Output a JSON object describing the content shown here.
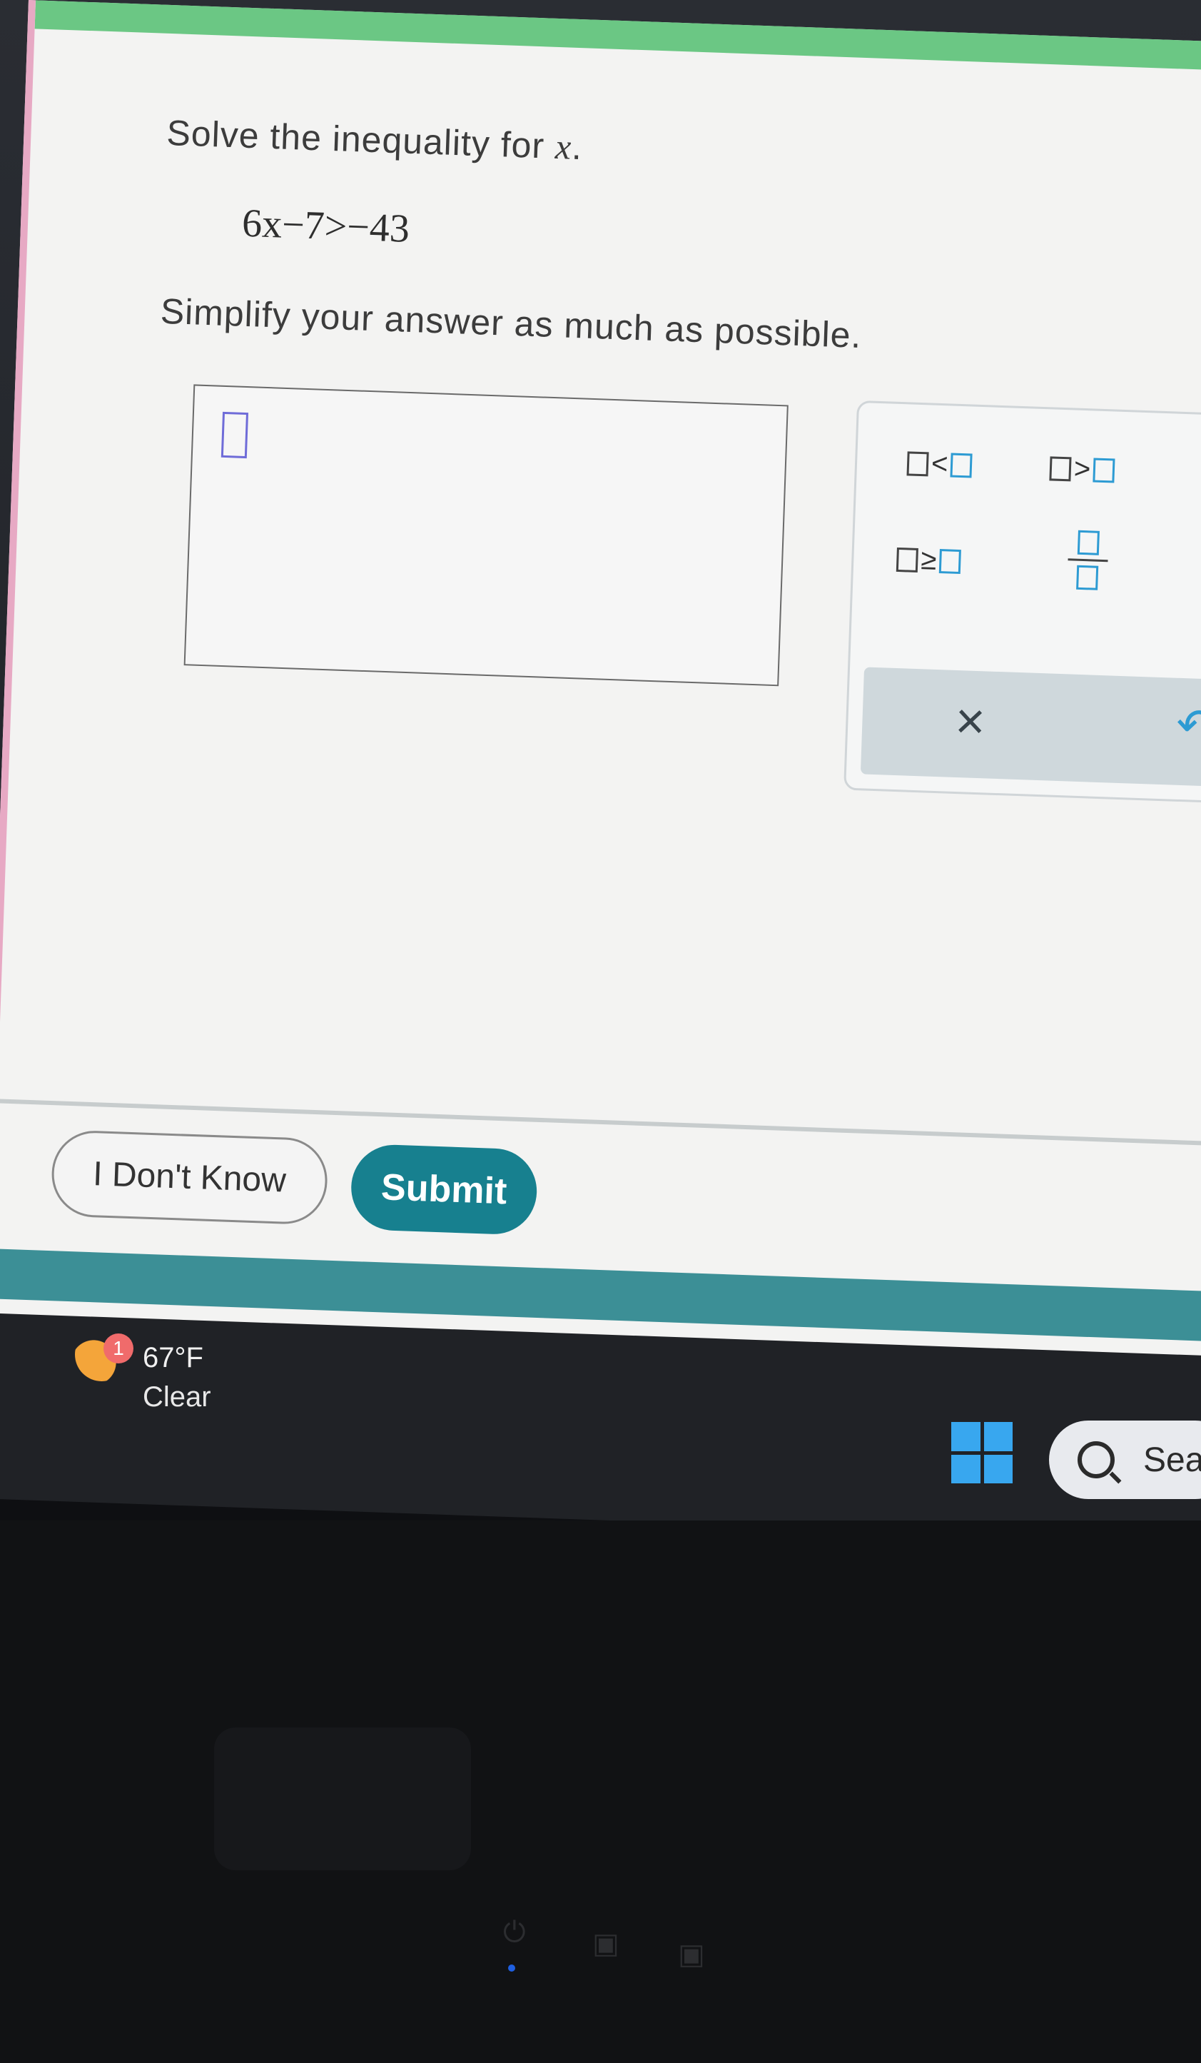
{
  "question": {
    "prefix": "Solve the inequality for ",
    "variable": "x",
    "suffix": "."
  },
  "equation": "6x−7>−43",
  "instruction": "Simplify your answer as much as possible.",
  "keypad": {
    "less_than": "<",
    "greater_than": ">",
    "greater_equal": "≥",
    "clear_symbol": "×",
    "undo_symbol": "↶"
  },
  "buttons": {
    "dont_know": "I Don't Know",
    "submit": "Submit"
  },
  "taskbar": {
    "weather_badge": "1",
    "temperature": "67°F",
    "condition": "Clear",
    "search_text": "Sea"
  },
  "colors": {
    "accent": "#17808f",
    "keypad_blue": "#2d9bd3",
    "cursor": "#6f6cd8"
  }
}
